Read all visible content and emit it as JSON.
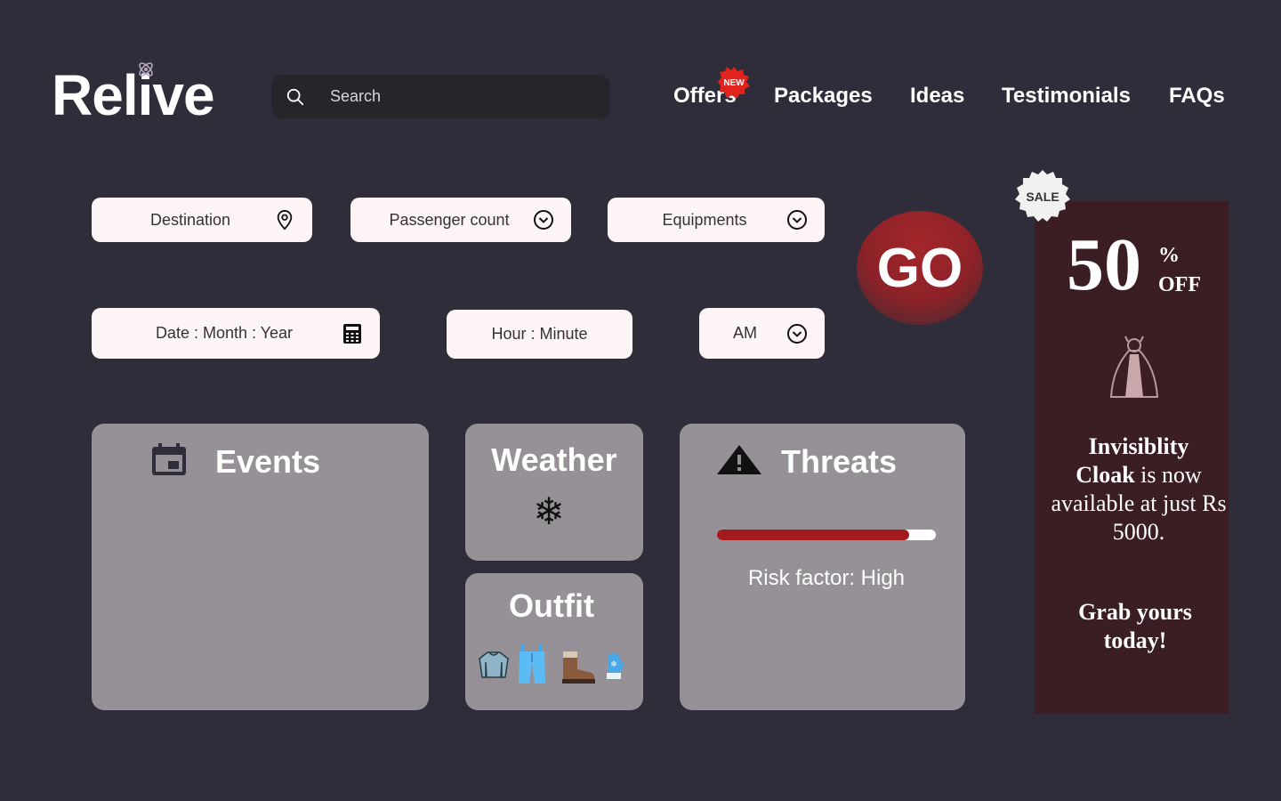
{
  "brand": {
    "name": "Relive"
  },
  "search": {
    "placeholder": "Search"
  },
  "nav": {
    "items": [
      {
        "label": "Offers",
        "badge": "NEW"
      },
      {
        "label": "Packages"
      },
      {
        "label": "Ideas"
      },
      {
        "label": "Testimonials"
      },
      {
        "label": "FAQs"
      }
    ]
  },
  "form": {
    "destination": {
      "label": "Destination",
      "icon": "location-pin-icon"
    },
    "passengers": {
      "label": "Passenger count",
      "icon": "chevron-down-icon"
    },
    "equipments": {
      "label": "Equipments",
      "icon": "chevron-down-icon"
    },
    "date": {
      "label": "Date : Month : Year",
      "icon": "calculator-icon"
    },
    "time": {
      "label": "Hour : Minute"
    },
    "ampm": {
      "label": "AM",
      "icon": "chevron-down-icon"
    },
    "go_label": "GO"
  },
  "cards": {
    "events": {
      "title": "Events",
      "icon": "calendar-icon"
    },
    "weather": {
      "title": "Weather",
      "icon": "snowflake-icon",
      "glyph": "❄"
    },
    "outfit": {
      "title": "Outfit",
      "items": [
        "sweater",
        "ski-pants",
        "boot",
        "mitten"
      ]
    },
    "threats": {
      "title": "Threats",
      "icon": "warning-icon",
      "risk_label": "Risk factor: High",
      "risk_level": 0.88
    }
  },
  "promo": {
    "sale_badge": "SALE",
    "discount_number": "50",
    "discount_percent": "%",
    "discount_off": "OFF",
    "product_icon": "cloak-icon",
    "line_bold_1": "Invisiblity",
    "line_bold_2": "Cloak",
    "line_rest": " is now available at just Rs 5000.",
    "cta": "Grab yours today!"
  },
  "colors": {
    "background": "#2f2d3a",
    "card": "#959197",
    "field": "#fdf5f5",
    "accent_red": "#a31a1d",
    "promo_bg": "#3b1d24"
  }
}
